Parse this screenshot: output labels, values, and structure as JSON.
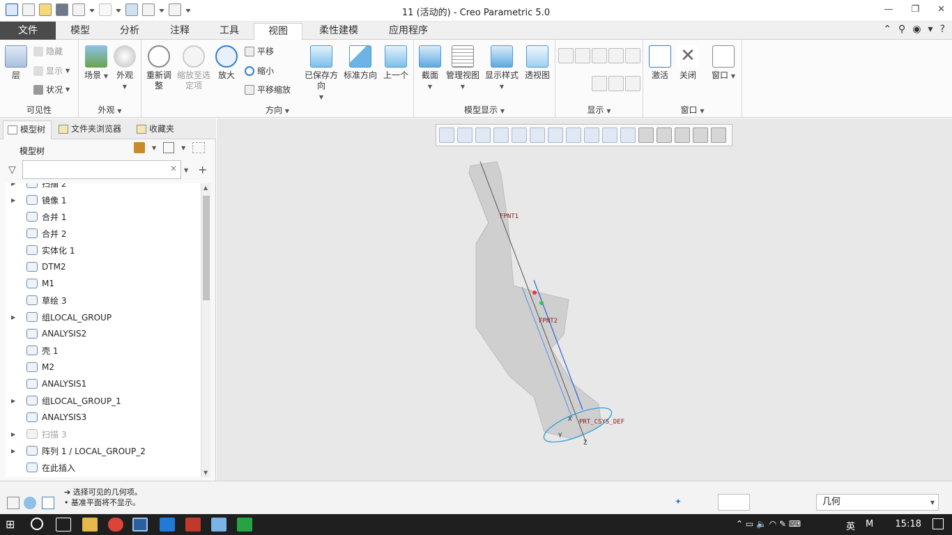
{
  "window": {
    "title": "11 (活动的) - Creo Parametric 5.0"
  },
  "tabs": [
    {
      "label": "文件"
    },
    {
      "label": "模型"
    },
    {
      "label": "分析"
    },
    {
      "label": "注释"
    },
    {
      "label": "工具"
    },
    {
      "label": "视图"
    },
    {
      "label": "柔性建模"
    },
    {
      "label": "应用程序"
    }
  ],
  "ribbon": {
    "visibility": {
      "layer": "层",
      "hide": "隐藏",
      "show": "显示",
      "status": "状况",
      "group": "可见性"
    },
    "appearance": {
      "scene": "场景",
      "appearance": "外观",
      "group": "外观"
    },
    "orientation": {
      "refit": "重新调整",
      "zoom_to_sel": "缩放至选定项",
      "zoom_in": "放大",
      "pan": "平移",
      "zoom_out": "缩小",
      "pan_zoom": "平移缩放",
      "saved": "已保存方向",
      "standard": "标准方向",
      "previous": "上一个",
      "group": "方向"
    },
    "model_display": {
      "section": "截面",
      "manage": "管理视图",
      "style": "显示样式",
      "perspective": "透视图",
      "group": "模型显示"
    },
    "display": {
      "group": "显示"
    },
    "window": {
      "activate": "激活",
      "close": "关闭",
      "windows": "窗口",
      "group": "窗口"
    }
  },
  "panel": {
    "tabs": [
      {
        "label": "模型树"
      },
      {
        "label": "文件夹浏览器"
      },
      {
        "label": "收藏夹"
      }
    ],
    "tree_label": "模型树",
    "filter_placeholder": "",
    "items": [
      {
        "label": "扫描 2",
        "expand": true,
        "grey": false
      },
      {
        "label": "镜像 1",
        "expand": true,
        "grey": false
      },
      {
        "label": "合并 1",
        "expand": false,
        "grey": false
      },
      {
        "label": "合并 2",
        "expand": false,
        "grey": false
      },
      {
        "label": "实体化 1",
        "expand": false,
        "grey": false
      },
      {
        "label": "DTM2",
        "expand": false,
        "grey": false
      },
      {
        "label": "M1",
        "expand": false,
        "grey": false
      },
      {
        "label": "草绘 3",
        "expand": false,
        "grey": false
      },
      {
        "label": "组LOCAL_GROUP",
        "expand": true,
        "grey": false
      },
      {
        "label": "ANALYSIS2",
        "expand": false,
        "grey": false
      },
      {
        "label": "壳 1",
        "expand": false,
        "grey": false
      },
      {
        "label": "M2",
        "expand": false,
        "grey": false
      },
      {
        "label": "ANALYSIS1",
        "expand": false,
        "grey": false
      },
      {
        "label": "组LOCAL_GROUP_1",
        "expand": true,
        "grey": false
      },
      {
        "label": "ANALYSIS3",
        "expand": false,
        "grey": false
      },
      {
        "label": "扫描 3",
        "expand": true,
        "grey": true
      },
      {
        "label": "阵列 1 / LOCAL_GROUP_2",
        "expand": true,
        "grey": false
      },
      {
        "label": "在此插入",
        "expand": false,
        "grey": false
      }
    ]
  },
  "viewport": {
    "labels": {
      "fpnt1": "FPNT1",
      "fpnt2": "FPNT2",
      "csys": "PRT_CSYS_DEF",
      "x": "X",
      "y": "Y",
      "z": "Z"
    }
  },
  "status": {
    "msg1": "选择可见的几何项。",
    "msg2": "基准平面将不显示。",
    "filter": "几何"
  },
  "taskbar": {
    "ime": "英",
    "ime2": "M",
    "time": "15:18"
  }
}
